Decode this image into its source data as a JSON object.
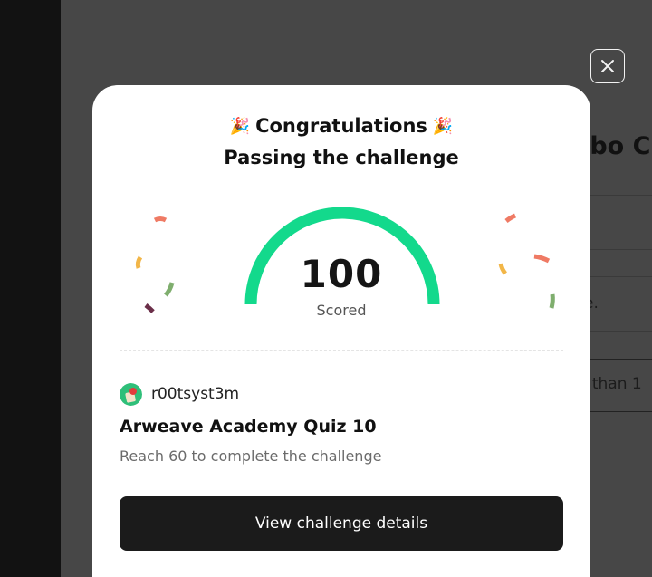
{
  "background": {
    "heading_fragment": "rbo C",
    "text_fragment": "e.",
    "box_fragment": "er than 1"
  },
  "modal": {
    "congrats": "Congratulations",
    "party_icon": "🎉",
    "subtitle": "Passing the challenge",
    "score": "100",
    "score_label": "Scored",
    "gauge_fraction": 1.0,
    "user": {
      "name": "r00tsyst3m"
    },
    "quiz_title": "Arweave Academy Quiz 10",
    "requirement": "Reach 60 to complete the challenge",
    "cta_label": "View challenge details"
  },
  "colors": {
    "gauge": "#13d98c",
    "confetti": [
      "#ef7a64",
      "#f2b648",
      "#7fae6e",
      "#6b2f49"
    ]
  }
}
